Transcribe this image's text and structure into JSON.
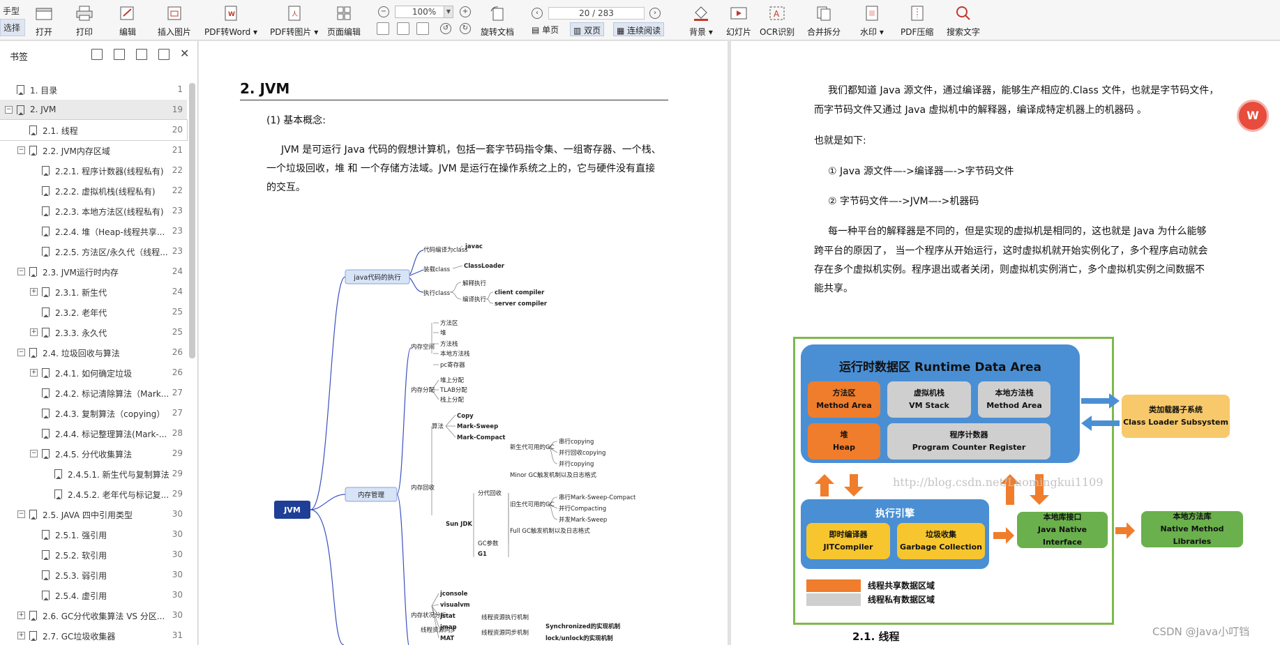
{
  "toolbar": {
    "mode_hand": "手型",
    "mode_select": "选择",
    "open": "打开",
    "print": "打印",
    "edit": "编辑",
    "insert_image": "插入图片",
    "pdf_to_word": "PDF转Word",
    "pdf_to_image": "PDF转图片",
    "page_edit": "页面编辑",
    "zoom": "100%",
    "page_indicator": "20 / 283",
    "rotate_doc": "旋转文档",
    "single_page": "单页",
    "double_page": "双页",
    "continuous": "连续阅读",
    "background": "背景",
    "slideshow": "幻灯片",
    "ocr": "OCR识别",
    "merge_split": "合并拆分",
    "watermark": "水印",
    "pdf_compress": "PDF压缩",
    "search_text": "搜索文字"
  },
  "sidebar": {
    "title": "书签",
    "items": [
      {
        "label": "1. 目录",
        "page": "1",
        "level": 0,
        "toggle": ""
      },
      {
        "label": "2. JVM",
        "page": "19",
        "level": 0,
        "toggle": "-"
      },
      {
        "label": "2.1. 线程",
        "page": "20",
        "level": 1,
        "toggle": ""
      },
      {
        "label": "2.2. JVM内存区域",
        "page": "21",
        "level": 1,
        "toggle": "-"
      },
      {
        "label": "2.2.1. 程序计数器(线程私有)",
        "page": "22",
        "level": 2,
        "toggle": ""
      },
      {
        "label": "2.2.2. 虚拟机栈(线程私有)",
        "page": "22",
        "level": 2,
        "toggle": ""
      },
      {
        "label": "2.2.3. 本地方法区(线程私有)",
        "page": "23",
        "level": 2,
        "toggle": ""
      },
      {
        "label": "2.2.4. 堆（Heap-线程共享...",
        "page": "23",
        "level": 2,
        "toggle": ""
      },
      {
        "label": "2.2.5. 方法区/永久代（线程...",
        "page": "23",
        "level": 2,
        "toggle": ""
      },
      {
        "label": "2.3. JVM运行时内存",
        "page": "24",
        "level": 1,
        "toggle": "-"
      },
      {
        "label": "2.3.1. 新生代",
        "page": "24",
        "level": 2,
        "toggle": "+"
      },
      {
        "label": "2.3.2. 老年代",
        "page": "25",
        "level": 2,
        "toggle": ""
      },
      {
        "label": "2.3.3. 永久代",
        "page": "25",
        "level": 2,
        "toggle": "+"
      },
      {
        "label": "2.4. 垃圾回收与算法",
        "page": "26",
        "level": 1,
        "toggle": "-"
      },
      {
        "label": "2.4.1. 如何确定垃圾",
        "page": "26",
        "level": 2,
        "toggle": "+"
      },
      {
        "label": "2.4.2. 标记清除算法（Mark...",
        "page": "27",
        "level": 2,
        "toggle": ""
      },
      {
        "label": "2.4.3. 复制算法（copying）",
        "page": "27",
        "level": 2,
        "toggle": ""
      },
      {
        "label": "2.4.4. 标记整理算法(Mark-...",
        "page": "28",
        "level": 2,
        "toggle": ""
      },
      {
        "label": "2.4.5. 分代收集算法",
        "page": "29",
        "level": 2,
        "toggle": "-"
      },
      {
        "label": "2.4.5.1. 新生代与复制算法",
        "page": "29",
        "level": 3,
        "toggle": ""
      },
      {
        "label": "2.4.5.2. 老年代与标记复...",
        "page": "29",
        "level": 3,
        "toggle": ""
      },
      {
        "label": "2.5. JAVA 四中引用类型",
        "page": "30",
        "level": 1,
        "toggle": "-"
      },
      {
        "label": "2.5.1. 强引用",
        "page": "30",
        "level": 2,
        "toggle": ""
      },
      {
        "label": "2.5.2. 软引用",
        "page": "30",
        "level": 2,
        "toggle": ""
      },
      {
        "label": "2.5.3. 弱引用",
        "page": "30",
        "level": 2,
        "toggle": ""
      },
      {
        "label": "2.5.4. 虚引用",
        "page": "30",
        "level": 2,
        "toggle": ""
      },
      {
        "label": "2.6. GC分代收集算法  VS 分区...",
        "page": "30",
        "level": 1,
        "toggle": "+"
      },
      {
        "label": "2.7. GC垃圾收集器",
        "page": "31",
        "level": 1,
        "toggle": "+"
      }
    ]
  },
  "left_page": {
    "heading": "2. JVM",
    "p1": "(1) 基本概念:",
    "p2a": "JVM 是可运行 Java 代码的假想计算机，包括一套字节码指令集、一组寄存器、一个栈、",
    "p2b": "一个垃圾回收，堆 和 一个存储方法域。JVM 是运行在操作系统之上的，它与硬件没有直接",
    "p2c": "的交互。",
    "mindmap": {
      "root": "JVM",
      "java_exec": "java代码的执行",
      "compile": "代码编译为class",
      "javac": "javac",
      "load": "装载class",
      "classloader": "ClassLoader",
      "exec": "执行class",
      "interp": "解释执行",
      "compile_exec": "编译执行",
      "client": "client compiler",
      "server": "server compiler",
      "mem_mgmt": "内存管理",
      "mem_space": "内存空间",
      "method_area": "方法区",
      "heap": "堆",
      "method_stack": "方法栈",
      "native_stack": "本地方法栈",
      "pc": "pc寄存器",
      "mem_alloc": "内存分配",
      "heap_alloc": "堆上分配",
      "tlab": "TLAB分配",
      "stack_alloc": "栈上分配",
      "mem_gc": "内存回收",
      "algo": "算法",
      "copy": "Copy",
      "mark_sweep": "Mark-Sweep",
      "mark_compact": "Mark-Compact",
      "sunjdk": "Sun JDK",
      "gen_gc": "分代回收",
      "young_gc": "新生代可用的GC",
      "serial_copying": "串行copying",
      "parallel_gc_copying": "并行回收copying",
      "parallel_copying": "并行copying",
      "minor_gc": "Minor GC触发机制以及日志格式",
      "old_gc": "旧生代可用的GC",
      "serial_msc": "串行Mark-Sweep-Compact",
      "parallel_compacting": "并行Compacting",
      "concurrent_ms": "并发Mark-Sweep",
      "full_gc": "Full GC触发机制以及日志格式",
      "gc_params": "GC参数",
      "g1": "G1",
      "mem_analysis": "内存状况分析",
      "jconsole": "jconsole",
      "visualvm": "visualvm",
      "jstat": "jstat",
      "jmap": "jmap",
      "mat": "MAT",
      "thread_sync": "线程资源同步",
      "thread_exec": "线程资源执行机制",
      "thread_sync_mech": "线程资源同步机制",
      "synchronized": "Synchronized的实现机制",
      "lock_unlock": "lock/unlock的实现机制"
    }
  },
  "right_page": {
    "p1a": "我们都知道 Java 源文件，通过编译器，能够生产相应的.Class 文件，也就是字节码文件，",
    "p1b": "而字节码文件又通过 Java 虚拟机中的解释器，编译成特定机器上的机器码 。",
    "p2": "也就是如下:",
    "p3": "① Java 源文件—->编译器—->字节码文件",
    "p4": "② 字节码文件—->JVM—->机器码",
    "p5a": "每一种平台的解释器是不同的，但是实现的虚拟机是相同的，这也就是 Java 为什么能够",
    "p5b": "跨平台的原因了， 当一个程序从开始运行，这时虚拟机就开始实例化了，多个程序启动就会",
    "p5c": "存在多个虚拟机实例。程序退出或者关闭，则虚拟机实例消亡，多个虚拟机实例之间数据不",
    "p5d": "能共享。",
    "diagram": {
      "title": "运行时数据区  Runtime Data Area",
      "method_area": "方法区",
      "method_area_en": "Method Area",
      "vm_stack": "虚拟机栈",
      "vm_stack_en": "VM Stack",
      "native_stack": "本地方法栈",
      "native_stack_en": "Method Area",
      "heap": "堆",
      "heap_en": "Heap",
      "pc": "程序计数器",
      "pc_en": "Program Counter Register",
      "class_loader": "类加载器子系统",
      "class_loader_en": "Class Loader Subsystem",
      "exec_engine": "执行引擎",
      "jit": "即时编译器",
      "jit_en": "JITCompiler",
      "gc": "垃圾收集",
      "gc_en": "Garbage Collection",
      "jni": "本地库接口",
      "jni_en": "Java Native Interface",
      "native_lib": "本地方法库",
      "native_lib_en": "Native Method Libraries",
      "legend_shared": "线程共享数据区域",
      "legend_private": "线程私有数据区域",
      "watermark": "http://blog.csdn.net/Luomingkui1109"
    },
    "caption": "2.1. 线程"
  },
  "footer_watermark": "CSDN @Java小叮铛",
  "colors": {
    "accent": "#e74c3c",
    "diagram_blue": "#4a8fd4",
    "diagram_orange": "#ef7d2c",
    "diagram_green": "#6ab04c",
    "diagram_yellow": "#f7c62f"
  }
}
